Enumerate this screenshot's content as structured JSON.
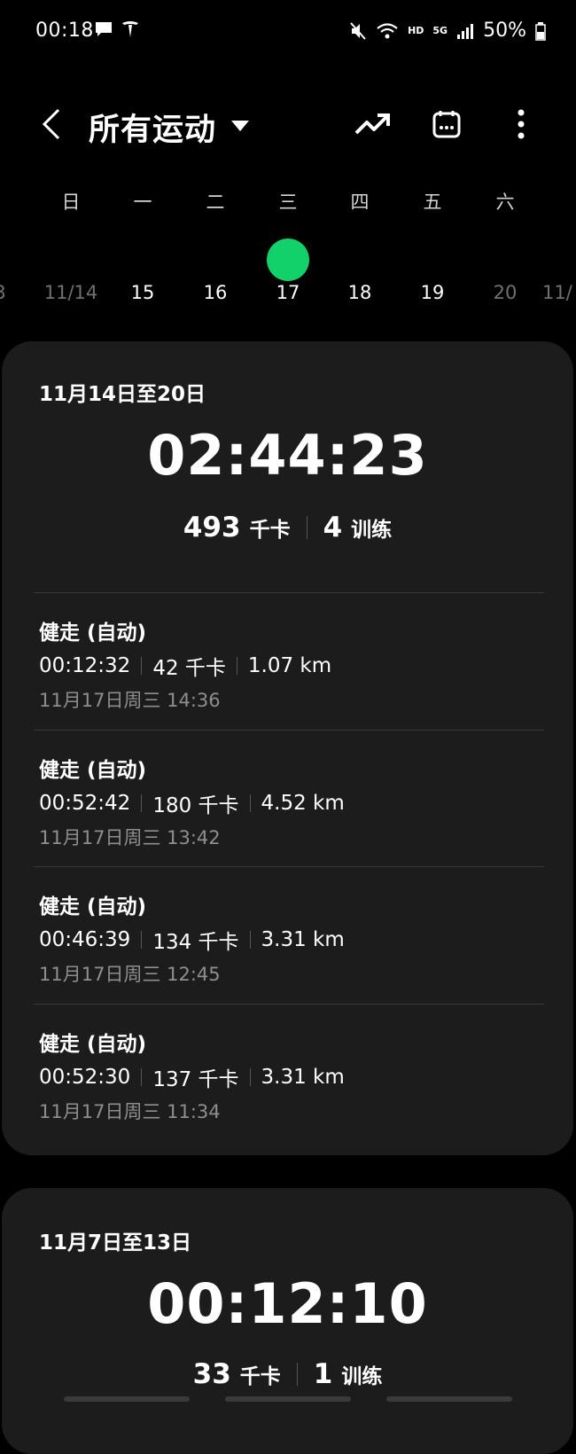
{
  "status_bar": {
    "time": "00:18",
    "network": "HD",
    "network_5g": "5G",
    "battery": "50%",
    "icons": [
      "message-icon",
      "tesla-icon",
      "mute-icon",
      "wifi-icon",
      "signal-icon",
      "battery-icon"
    ]
  },
  "header": {
    "title": "所有运动",
    "icons": [
      "back-icon",
      "dropdown-icon",
      "trend-icon",
      "calendar-icon",
      "more-icon"
    ]
  },
  "calendar": {
    "weekdays": [
      "日",
      "一",
      "二",
      "三",
      "四",
      "五",
      "六"
    ],
    "dates": [
      "3",
      "11/14",
      "15",
      "16",
      "17",
      "18",
      "19",
      "20",
      "11/"
    ],
    "selected": "17",
    "accent": "#13d16a"
  },
  "weeks": [
    {
      "range": "11月14日至20日",
      "total_time": "02:44:23",
      "calories": "493",
      "calories_unit": "千卡",
      "workouts_count": "4",
      "workouts_unit": "训练",
      "workouts": [
        {
          "name": "健走 (自动)",
          "duration": "00:12:32",
          "calories": "42 千卡",
          "distance": "1.07 km",
          "date": "11月17日周三 14:36"
        },
        {
          "name": "健走 (自动)",
          "duration": "00:52:42",
          "calories": "180 千卡",
          "distance": "4.52 km",
          "date": "11月17日周三 13:42"
        },
        {
          "name": "健走 (自动)",
          "duration": "00:46:39",
          "calories": "134 千卡",
          "distance": "3.31 km",
          "date": "11月17日周三 12:45"
        },
        {
          "name": "健走 (自动)",
          "duration": "00:52:30",
          "calories": "137 千卡",
          "distance": "3.31 km",
          "date": "11月17日周三 11:34"
        }
      ]
    },
    {
      "range": "11月7日至13日",
      "total_time": "00:12:10",
      "calories": "33",
      "calories_unit": "千卡",
      "workouts_count": "1",
      "workouts_unit": "训练"
    }
  ],
  "colors": {
    "background": "#000000",
    "card": "#1c1c1c",
    "accent": "#13d16a",
    "muted_text": "#8e8e8e"
  }
}
